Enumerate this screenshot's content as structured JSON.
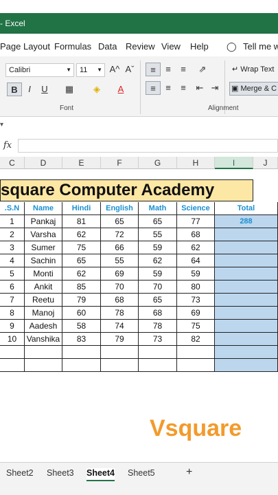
{
  "title_bar": {
    "text": "- Excel"
  },
  "menu_tabs": [
    "Page Layout",
    "Formulas",
    "Data",
    "Review",
    "View",
    "Help"
  ],
  "tell_me": "Tell me w",
  "ribbon": {
    "font_name": "Calibri",
    "font_size": "11",
    "font_group_label": "Font",
    "alignment_group_label": "Alignment",
    "wrap_text_label": "Wrap Text",
    "merge_label": "Merge & C",
    "bold": "B",
    "italic": "I",
    "underline": "U",
    "grow_font": "A^",
    "shrink_font": "Aˇ"
  },
  "formula_bar": {
    "fx_label": "fx",
    "value": ""
  },
  "columns": [
    "C",
    "D",
    "E",
    "F",
    "G",
    "H",
    "I",
    "J"
  ],
  "selected_column": "I",
  "banner_text": "square Computer Academy",
  "table": {
    "headers": [
      ".S.N",
      "Name",
      "Hindi",
      "English",
      "Math",
      "Science",
      "Total"
    ],
    "rows": [
      [
        "1",
        "Pankaj",
        "81",
        "65",
        "65",
        "77",
        "288"
      ],
      [
        "2",
        "Varsha",
        "62",
        "72",
        "55",
        "68",
        ""
      ],
      [
        "3",
        "Sumer",
        "75",
        "66",
        "59",
        "62",
        ""
      ],
      [
        "4",
        "Sachin",
        "65",
        "55",
        "62",
        "64",
        ""
      ],
      [
        "5",
        "Monti",
        "62",
        "69",
        "59",
        "59",
        ""
      ],
      [
        "6",
        "Ankit",
        "85",
        "70",
        "70",
        "80",
        ""
      ],
      [
        "7",
        "Reetu",
        "79",
        "68",
        "65",
        "73",
        ""
      ],
      [
        "8",
        "Manoj",
        "60",
        "78",
        "68",
        "69",
        ""
      ],
      [
        "9",
        "Aadesh",
        "58",
        "74",
        "78",
        "75",
        ""
      ],
      [
        "10",
        "Vanshika",
        "83",
        "79",
        "73",
        "82",
        ""
      ],
      [
        "",
        "",
        "",
        "",
        "",
        "",
        ""
      ],
      [
        "",
        "",
        "",
        "",
        "",
        "",
        ""
      ]
    ]
  },
  "watermark": "Vsquare",
  "sheet_tabs": [
    "Sheet2",
    "Sheet3",
    "Sheet4",
    "Sheet5"
  ],
  "active_sheet": "Sheet4",
  "add_sheet": "+",
  "colors": {
    "excel_green": "#217346",
    "header_blue": "#1a8fd0",
    "banner_fill": "#fde7a4",
    "total_fill": "#bcd6ee",
    "watermark": "#f39a2b"
  }
}
